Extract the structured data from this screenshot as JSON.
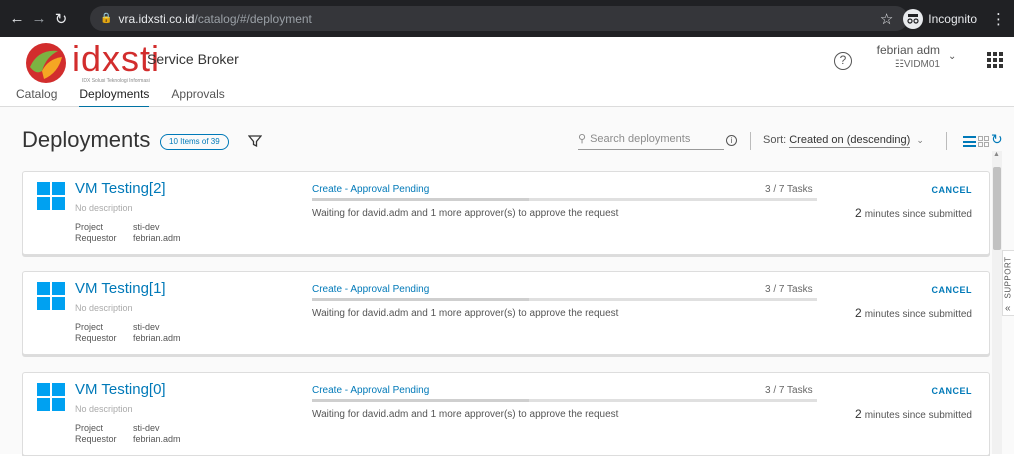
{
  "browser": {
    "url_domain": "vra.idxsti.co.id",
    "url_path": "/catalog/#/deployment",
    "incognito_label": "Incognito"
  },
  "header": {
    "brand": "idxsti",
    "brand_tagline": "IDX Solusi Teknologi Informasi",
    "app_title": "Service Broker",
    "user_name": "febrian adm",
    "user_tenant": "VIDM01",
    "tabs": [
      {
        "label": "Catalog",
        "active": false
      },
      {
        "label": "Deployments",
        "active": true
      },
      {
        "label": "Approvals",
        "active": false
      }
    ]
  },
  "toolbar": {
    "page_title": "Deployments",
    "count_badge": "10 Items of 39",
    "search_placeholder": "Search deployments",
    "sort_label": "Sort:",
    "sort_value": "Created on (descending)"
  },
  "deployments": [
    {
      "name": "VM Testing[2]",
      "description": "No description",
      "project_label": "Project",
      "project": "sti-dev",
      "requestor_label": "Requestor",
      "requestor": "febrian.adm",
      "status": "Create - Approval Pending",
      "tasks": "3 / 7  Tasks",
      "progress": 0.43,
      "message": "Waiting for david.adm and 1 more approver(s) to approve the request",
      "cancel_label": "CANCEL",
      "time_num": "2",
      "time_text": "minutes since submitted"
    },
    {
      "name": "VM Testing[1]",
      "description": "No description",
      "project_label": "Project",
      "project": "sti-dev",
      "requestor_label": "Requestor",
      "requestor": "febrian.adm",
      "status": "Create - Approval Pending",
      "tasks": "3 / 7  Tasks",
      "progress": 0.43,
      "message": "Waiting for david.adm and 1 more approver(s) to approve the request",
      "cancel_label": "CANCEL",
      "time_num": "2",
      "time_text": "minutes since submitted"
    },
    {
      "name": "VM Testing[0]",
      "description": "No description",
      "project_label": "Project",
      "project": "sti-dev",
      "requestor_label": "Requestor",
      "requestor": "febrian.adm",
      "status": "Create - Approval Pending",
      "tasks": "3 / 7  Tasks",
      "progress": 0.43,
      "message": "Waiting for david.adm and 1 more approver(s) to approve the request",
      "cancel_label": "CANCEL",
      "time_num": "2",
      "time_text": "minutes since submitted"
    }
  ],
  "support_label": "SUPPORT",
  "colors": {
    "accent": "#0079b8",
    "brand_red": "#d22d2d",
    "windows_blue": "#00a1f1"
  }
}
